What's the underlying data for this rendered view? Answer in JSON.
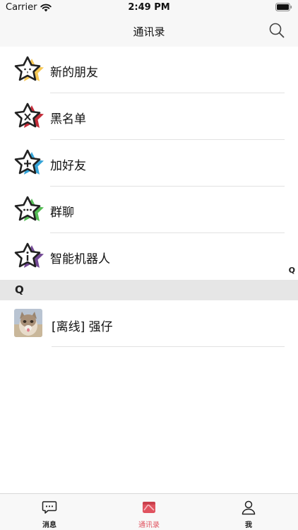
{
  "status_bar": {
    "carrier": "Carrier",
    "time": "2:49 PM"
  },
  "header": {
    "title": "通讯录",
    "search_icon": "search-icon"
  },
  "function_items": [
    {
      "label": "新的朋友",
      "icon": "star-face-icon",
      "accent": "#f5c242"
    },
    {
      "label": "黑名单",
      "icon": "star-x-icon",
      "accent": "#c0212e"
    },
    {
      "label": "加好友",
      "icon": "star-plus-icon",
      "accent": "#2a9fd6"
    },
    {
      "label": "群聊",
      "icon": "star-dots-icon",
      "accent": "#4cb84c"
    },
    {
      "label": "智能机器人",
      "icon": "star-info-icon",
      "accent": "#6b3f8f"
    }
  ],
  "index_bar": {
    "letter": "Q"
  },
  "sections": [
    {
      "letter": "Q",
      "contacts": [
        {
          "label": "[离线] 强仔",
          "avatar": "cat-avatar"
        }
      ]
    }
  ],
  "tabs": [
    {
      "label": "消息",
      "icon": "chat-icon",
      "active": false
    },
    {
      "label": "通讯录",
      "icon": "contacts-icon",
      "active": true
    },
    {
      "label": "我",
      "icon": "person-icon",
      "active": false
    }
  ],
  "colors": {
    "active_tab": "#e0535f",
    "section_bg": "#e6e6e6",
    "header_bg": "#f7f7f7"
  }
}
